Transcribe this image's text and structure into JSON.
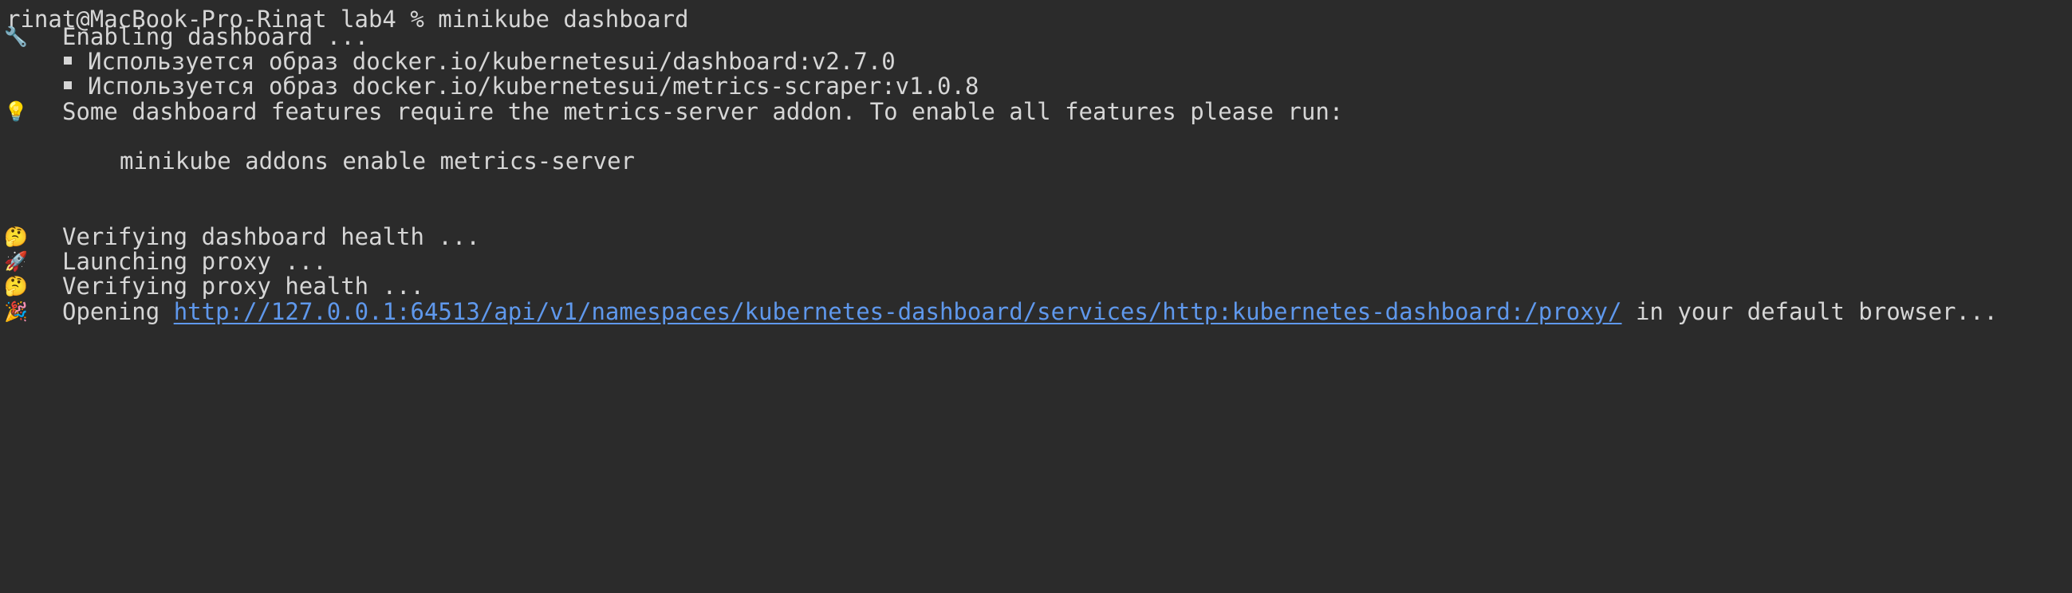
{
  "prompt": "rinat@MacBook-Pro-Rinat lab4 % ",
  "command": "minikube dashboard",
  "lines": [
    {
      "icon": "wrench-icon",
      "text": "Enabling dashboard ..."
    },
    {
      "bullet": true,
      "text": "Используется образ docker.io/kubernetesui/dashboard:v2.7.0"
    },
    {
      "bullet": true,
      "text": "Используется образ docker.io/kubernetesui/metrics-scraper:v1.0.8"
    },
    {
      "icon": "lightbulb-icon",
      "text": "Some dashboard features require the metrics-server addon. To enable all features please run:"
    },
    {
      "text": "minikube addons enable metrics-server"
    },
    {
      "icon": "thinking-face-icon",
      "text": "Verifying dashboard health ..."
    },
    {
      "icon": "rocket-icon",
      "text": "Launching proxy ..."
    },
    {
      "icon": "thinking-face-icon",
      "text": "Verifying proxy health ..."
    },
    {
      "icon": "party-popper-icon",
      "text_before": "Opening ",
      "link": "http://127.0.0.1:64513/api/v1/namespaces/kubernetes-dashboard/services/http:kubernetes-dashboard:/proxy/",
      "text_after": " in your default browser..."
    }
  ],
  "colors": {
    "background": "#2b2b2b",
    "text": "#d6d6d6",
    "link": "#5f98ec"
  }
}
